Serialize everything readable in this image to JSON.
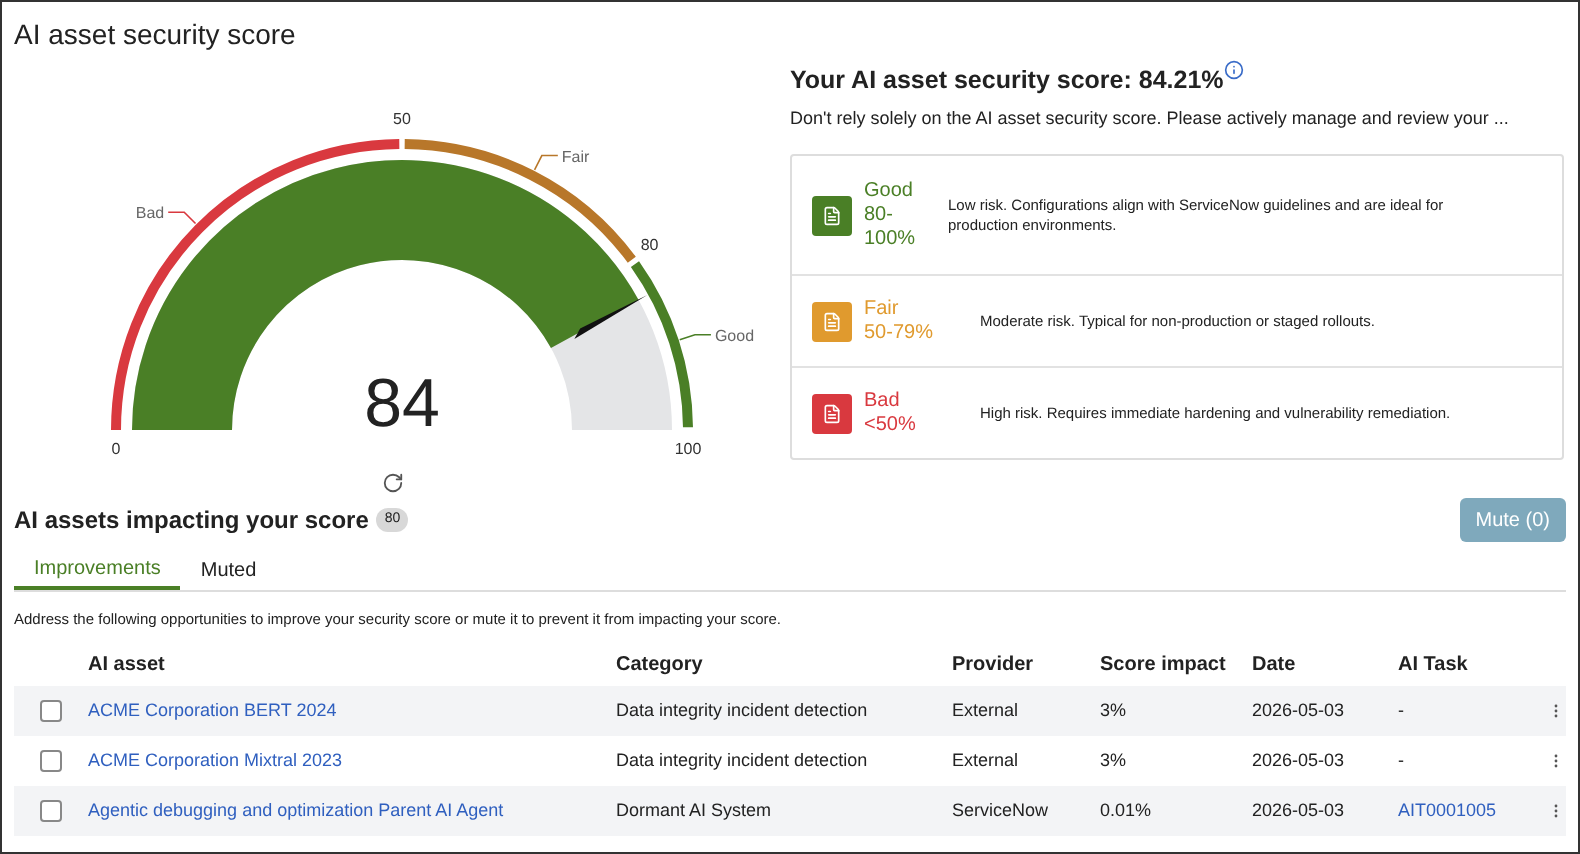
{
  "title": "AI asset security score",
  "gauge": {
    "value": "84",
    "ticks": [
      "0",
      "50",
      "80",
      "100"
    ],
    "segments": [
      {
        "label": "Bad",
        "color": "#d9393f"
      },
      {
        "label": "Fair",
        "color": "#b8772a"
      },
      {
        "label": "Good",
        "color": "#4a7f26"
      }
    ]
  },
  "score": {
    "title": "Your AI asset security score: 84.21%",
    "disclaimer": "Don't rely solely on the AI asset security score. Please actively manage and review your ..."
  },
  "ratings": [
    {
      "name": "Good",
      "range": "80-100%",
      "description": "Low risk. Configurations align with ServiceNow guidelines and are ideal for production environments.",
      "color": "#4a7f26"
    },
    {
      "name": "Fair",
      "range": "50-79%",
      "description": "Moderate risk. Typical for non-production or staged rollouts.",
      "color": "#e09a2e"
    },
    {
      "name": "Bad",
      "range": "<50%",
      "description": "High risk. Requires immediate hardening and vulnerability remediation.",
      "color": "#d9393f"
    }
  ],
  "assets": {
    "title": "AI assets impacting your score",
    "count": "80",
    "mute_button": {
      "label": "Mute (0)",
      "disabled": true
    },
    "tabs": [
      {
        "label": "Improvements",
        "selected": true
      },
      {
        "label": "Muted",
        "selected": false
      }
    ],
    "description": "Address the following opportunities to improve your security score or mute it to prevent it from impacting your score.",
    "columns": [
      "AI asset",
      "Category",
      "Provider",
      "Score impact",
      "Date",
      "AI Task"
    ],
    "rows": [
      {
        "checked": false,
        "asset": "ACME Corporation BERT 2024",
        "category": "Data integrity incident detection",
        "provider": "External",
        "impact": "3%",
        "date": "2026-05-03",
        "task": "-",
        "task_link": false
      },
      {
        "checked": false,
        "asset": "ACME Corporation Mixtral 2023",
        "category": "Data integrity incident detection",
        "provider": "External",
        "impact": "3%",
        "date": "2026-05-03",
        "task": "-",
        "task_link": false
      },
      {
        "checked": false,
        "asset": "Agentic debugging and optimization Parent AI Agent",
        "category": "Dormant AI System",
        "provider": "ServiceNow",
        "impact": "0.01%",
        "date": "2026-05-03",
        "task": "AIT0001005",
        "task_link": true
      }
    ]
  }
}
